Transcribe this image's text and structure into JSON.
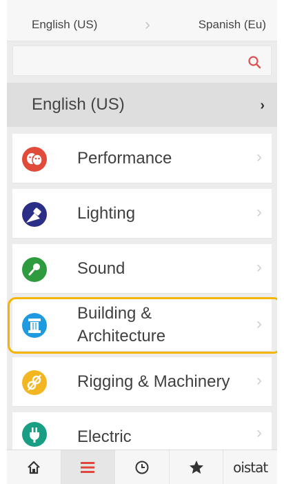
{
  "lang_bar": {
    "source": "English (US)",
    "target": "Spanish (Eu)"
  },
  "search": {
    "placeholder": "",
    "icon": "search-icon",
    "icon_color": "#d9534f"
  },
  "section": {
    "title": "English (US)"
  },
  "categories": [
    {
      "label": "Performance",
      "icon": "theater-masks-icon",
      "color": "#e04b3a"
    },
    {
      "label": "Lighting",
      "icon": "spotlight-icon",
      "color": "#2c2f86"
    },
    {
      "label": "Sound",
      "icon": "microphone-icon",
      "color": "#2e9b3f"
    },
    {
      "label": "Building &",
      "label2": "Architecture",
      "icon": "column-icon",
      "color": "#1e9be0",
      "highlighted": true
    },
    {
      "label": "Rigging & Machinery",
      "icon": "gears-icon",
      "color": "#f3b623"
    },
    {
      "label": "Electric",
      "icon": "plug-icon",
      "color": "#1a9e83"
    }
  ],
  "tabbar": {
    "items": [
      {
        "name": "home",
        "icon": "home-icon"
      },
      {
        "name": "menu",
        "icon": "menu-icon",
        "active": true,
        "color": "#e0463c"
      },
      {
        "name": "history",
        "icon": "clock-icon"
      },
      {
        "name": "favorites",
        "icon": "star-icon"
      },
      {
        "name": "brand",
        "label": "oistat"
      }
    ]
  },
  "colors": {
    "highlight": "#f4b400",
    "chevron": "#d0d0d0"
  }
}
